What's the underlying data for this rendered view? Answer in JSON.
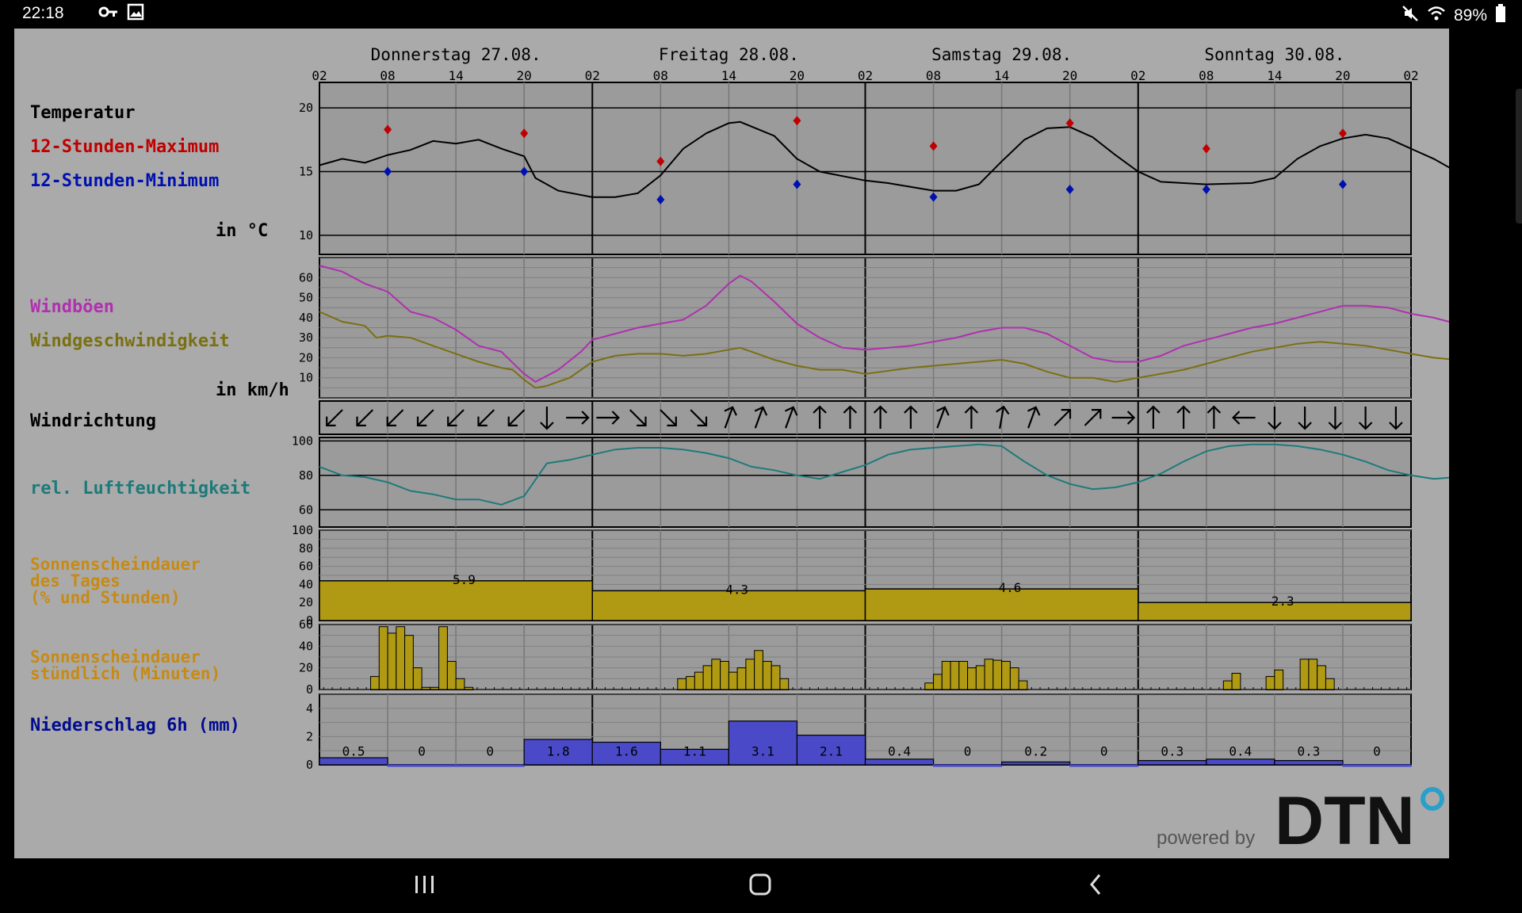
{
  "status_bar": {
    "time": "22:18",
    "battery": "89%"
  },
  "labels": {
    "temperatur": "Temperatur",
    "max": "12-Stunden-Maximum",
    "min": "12-Stunden-Minimum",
    "temp_unit": "in °C",
    "windboeen": "Windböen",
    "windgeschw": "Windgeschwindigkeit",
    "wind_unit": "in km/h",
    "windrichtung": "Windrichtung",
    "feuchte": "rel. Luftfeuchtigkeit",
    "sonne_tag_1": "Sonnenscheindauer",
    "sonne_tag_2": "des Tages",
    "sonne_tag_3": "(% und Stunden)",
    "sonne_std_1": "Sonnenscheindauer",
    "sonne_std_2": "stündlich (Minuten)",
    "niederschlag": "Niederschlag 6h (mm)"
  },
  "colors": {
    "max": "#c00000",
    "min": "#0010b0",
    "gusts": "#b030b0",
    "wind": "#7a7012",
    "humidity": "#1e7a7a",
    "sun_label": "#c88a14",
    "sun_fill": "#b09a14",
    "precip_label": "#000c90",
    "precip_fill": "#4a4ac8",
    "panel": "#9b9b9b",
    "grid": "#777777"
  },
  "branding": {
    "powered_by": "powered by",
    "logo": "DTN"
  },
  "chart_data": {
    "type": "multi-panel meteogram",
    "days": [
      "Donnerstag 27.08.",
      "Freitag 28.08.",
      "Samstag 29.08.",
      "Sonntag 30.08."
    ],
    "hour_ticks": [
      "02",
      "08",
      "14",
      "20",
      "02",
      "08",
      "14",
      "20",
      "02",
      "08",
      "14",
      "20",
      "02",
      "08",
      "14",
      "20",
      "02"
    ],
    "temperature": {
      "yticks": [
        10,
        15,
        20
      ],
      "ylim": [
        8.5,
        22
      ],
      "curve": [
        [
          2,
          15.5
        ],
        [
          4,
          16
        ],
        [
          6,
          15.7
        ],
        [
          8,
          16.3
        ],
        [
          10,
          16.7
        ],
        [
          12,
          17.4
        ],
        [
          14,
          17.2
        ],
        [
          16,
          17.5
        ],
        [
          18,
          16.8
        ],
        [
          20,
          16.2
        ],
        [
          21,
          14.5
        ],
        [
          23,
          13.5
        ],
        [
          26,
          13.0
        ],
        [
          28,
          13.0
        ],
        [
          30,
          13.3
        ],
        [
          32,
          14.7
        ],
        [
          34,
          16.8
        ],
        [
          36,
          18.0
        ],
        [
          38,
          18.8
        ],
        [
          39,
          18.9
        ],
        [
          42,
          17.8
        ],
        [
          44,
          16.0
        ],
        [
          46,
          15.0
        ],
        [
          50,
          14.3
        ],
        [
          52,
          14.1
        ],
        [
          56,
          13.5
        ],
        [
          58,
          13.5
        ],
        [
          60,
          14.0
        ],
        [
          62,
          15.8
        ],
        [
          64,
          17.5
        ],
        [
          66,
          18.4
        ],
        [
          68,
          18.5
        ],
        [
          70,
          17.7
        ],
        [
          72,
          16.3
        ],
        [
          74,
          15.0
        ],
        [
          76,
          14.2
        ],
        [
          80,
          14.0
        ],
        [
          84,
          14.1
        ],
        [
          86,
          14.5
        ],
        [
          88,
          16.0
        ],
        [
          90,
          17.0
        ],
        [
          92,
          17.6
        ],
        [
          94,
          17.9
        ],
        [
          96,
          17.6
        ],
        [
          98,
          16.8
        ],
        [
          100,
          16.0
        ],
        [
          102,
          15.0
        ],
        [
          104,
          14.6
        ],
        [
          106,
          14.1
        ],
        [
          108,
          13.7
        ]
      ],
      "max_points": [
        [
          8,
          18.3
        ],
        [
          20,
          18.0
        ],
        [
          32,
          15.8
        ],
        [
          44,
          19.0
        ],
        [
          56,
          17.0
        ],
        [
          68,
          18.8
        ],
        [
          80,
          16.8
        ],
        [
          92,
          18.0
        ]
      ],
      "min_points": [
        [
          8,
          15.0
        ],
        [
          20,
          15.0
        ],
        [
          32,
          12.8
        ],
        [
          44,
          14.0
        ],
        [
          56,
          13.0
        ],
        [
          68,
          13.6
        ],
        [
          80,
          13.6
        ],
        [
          92,
          14.0
        ]
      ]
    },
    "wind": {
      "yticks": [
        10,
        20,
        30,
        40,
        50,
        60
      ],
      "ylim": [
        0,
        70
      ],
      "gusts": [
        [
          2,
          66
        ],
        [
          4,
          63
        ],
        [
          6,
          57
        ],
        [
          8,
          53
        ],
        [
          10,
          43
        ],
        [
          12,
          40
        ],
        [
          14,
          34
        ],
        [
          16,
          26
        ],
        [
          18,
          23
        ],
        [
          20,
          12
        ],
        [
          21,
          8
        ],
        [
          23,
          14
        ],
        [
          25,
          23
        ],
        [
          26,
          29
        ],
        [
          28,
          32
        ],
        [
          30,
          35
        ],
        [
          32,
          37
        ],
        [
          34,
          39
        ],
        [
          36,
          46
        ],
        [
          38,
          57
        ],
        [
          39,
          61
        ],
        [
          40,
          58
        ],
        [
          42,
          48
        ],
        [
          44,
          37
        ],
        [
          46,
          30
        ],
        [
          48,
          25
        ],
        [
          50,
          24
        ],
        [
          54,
          26
        ],
        [
          56,
          28
        ],
        [
          58,
          30
        ],
        [
          60,
          33
        ],
        [
          62,
          35
        ],
        [
          64,
          35
        ],
        [
          66,
          32
        ],
        [
          68,
          26
        ],
        [
          70,
          20
        ],
        [
          72,
          18
        ],
        [
          74,
          18
        ],
        [
          76,
          21
        ],
        [
          78,
          26
        ],
        [
          80,
          29
        ],
        [
          82,
          32
        ],
        [
          84,
          35
        ],
        [
          86,
          37
        ],
        [
          88,
          40
        ],
        [
          90,
          43
        ],
        [
          92,
          46
        ],
        [
          94,
          46
        ],
        [
          96,
          45
        ],
        [
          98,
          42
        ],
        [
          100,
          40
        ],
        [
          102,
          37
        ],
        [
          104,
          35
        ],
        [
          106,
          33
        ]
      ],
      "speed": [
        [
          2,
          43
        ],
        [
          4,
          38
        ],
        [
          6,
          36
        ],
        [
          7,
          30
        ],
        [
          8,
          31
        ],
        [
          10,
          30
        ],
        [
          12,
          26
        ],
        [
          14,
          22
        ],
        [
          16,
          18
        ],
        [
          18,
          15
        ],
        [
          19,
          14
        ],
        [
          20,
          9
        ],
        [
          21,
          5
        ],
        [
          22,
          6
        ],
        [
          24,
          10
        ],
        [
          26,
          18
        ],
        [
          28,
          21
        ],
        [
          30,
          22
        ],
        [
          32,
          22
        ],
        [
          34,
          21
        ],
        [
          36,
          22
        ],
        [
          38,
          24
        ],
        [
          39,
          25
        ],
        [
          40,
          23
        ],
        [
          42,
          19
        ],
        [
          44,
          16
        ],
        [
          46,
          14
        ],
        [
          48,
          14
        ],
        [
          50,
          12
        ],
        [
          54,
          15
        ],
        [
          56,
          16
        ],
        [
          58,
          17
        ],
        [
          60,
          18
        ],
        [
          62,
          19
        ],
        [
          64,
          17
        ],
        [
          66,
          13
        ],
        [
          68,
          10
        ],
        [
          70,
          10
        ],
        [
          72,
          8
        ],
        [
          74,
          10
        ],
        [
          76,
          12
        ],
        [
          78,
          14
        ],
        [
          80,
          17
        ],
        [
          82,
          20
        ],
        [
          84,
          23
        ],
        [
          86,
          25
        ],
        [
          88,
          27
        ],
        [
          90,
          28
        ],
        [
          92,
          27
        ],
        [
          94,
          26
        ],
        [
          96,
          24
        ],
        [
          98,
          22
        ],
        [
          100,
          20
        ],
        [
          102,
          19
        ],
        [
          104,
          17
        ]
      ]
    },
    "wind_direction_deg": [
      45,
      45,
      45,
      45,
      45,
      45,
      45,
      0,
      270,
      270,
      315,
      315,
      315,
      200,
      200,
      200,
      180,
      180,
      180,
      180,
      200,
      180,
      190,
      200,
      225,
      225,
      270,
      180,
      180,
      180,
      90,
      0,
      0,
      0,
      0,
      0
    ],
    "humidity": {
      "yticks": [
        60,
        80,
        100
      ],
      "ylim": [
        50,
        102
      ],
      "curve": [
        [
          2,
          85
        ],
        [
          4,
          80
        ],
        [
          6,
          79
        ],
        [
          8,
          76
        ],
        [
          10,
          71
        ],
        [
          12,
          69
        ],
        [
          14,
          66
        ],
        [
          16,
          66
        ],
        [
          18,
          63
        ],
        [
          20,
          68
        ],
        [
          22,
          87
        ],
        [
          24,
          89
        ],
        [
          26,
          92
        ],
        [
          28,
          95
        ],
        [
          30,
          96
        ],
        [
          32,
          96
        ],
        [
          34,
          95
        ],
        [
          36,
          93
        ],
        [
          38,
          90
        ],
        [
          40,
          85
        ],
        [
          42,
          83
        ],
        [
          44,
          80
        ],
        [
          46,
          78
        ],
        [
          48,
          82
        ],
        [
          50,
          86
        ],
        [
          52,
          92
        ],
        [
          54,
          95
        ],
        [
          56,
          96
        ],
        [
          58,
          97
        ],
        [
          60,
          98
        ],
        [
          62,
          97
        ],
        [
          64,
          88
        ],
        [
          66,
          80
        ],
        [
          68,
          75
        ],
        [
          70,
          72
        ],
        [
          72,
          73
        ],
        [
          74,
          76
        ],
        [
          76,
          81
        ],
        [
          78,
          88
        ],
        [
          80,
          94
        ],
        [
          82,
          97
        ],
        [
          84,
          98
        ],
        [
          86,
          98
        ],
        [
          88,
          97
        ],
        [
          90,
          95
        ],
        [
          92,
          92
        ],
        [
          94,
          88
        ],
        [
          96,
          83
        ],
        [
          98,
          80
        ],
        [
          100,
          78
        ],
        [
          102,
          79
        ],
        [
          104,
          80
        ],
        [
          106,
          81
        ]
      ]
    },
    "sunshine_daily": {
      "yticks": [
        0,
        20,
        40,
        60,
        80,
        100
      ],
      "ylim": [
        0,
        100
      ],
      "percent": [
        44,
        33,
        35,
        20
      ],
      "hours": [
        "5.9",
        "4.3",
        "4.6",
        "2.3"
      ]
    },
    "sunshine_hourly": {
      "yticks": [
        0,
        20,
        40,
        60
      ],
      "ylim": [
        0,
        60
      ],
      "minutes": [
        0,
        0,
        0,
        0,
        0,
        0,
        12,
        58,
        52,
        58,
        50,
        20,
        2,
        2,
        58,
        26,
        10,
        2,
        0,
        0,
        0,
        0,
        0,
        0,
        0,
        0,
        0,
        0,
        0,
        0,
        0,
        0,
        0,
        0,
        0,
        0,
        0,
        0,
        0,
        0,
        0,
        0,
        10,
        12,
        16,
        22,
        28,
        26,
        16,
        20,
        28,
        36,
        26,
        22,
        10,
        0,
        0,
        0,
        0,
        0,
        0,
        0,
        0,
        0,
        0,
        0,
        0,
        0,
        0,
        0,
        0,
        6,
        14,
        26,
        26,
        26,
        20,
        22,
        28,
        27,
        26,
        20,
        8,
        0,
        0,
        0,
        0,
        0,
        0,
        0,
        0,
        0,
        0,
        0,
        0,
        0,
        0,
        0,
        0,
        0,
        0,
        0,
        0,
        0,
        0,
        0,
        8,
        15,
        0,
        0,
        0,
        12,
        18,
        0,
        0,
        28,
        28,
        22,
        10,
        0,
        0,
        0,
        0,
        0,
        0,
        0,
        0,
        0
      ]
    },
    "precipitation_6h": {
      "yticks": [
        0,
        2,
        4
      ],
      "ylim": [
        0,
        5
      ],
      "values": [
        0.5,
        0,
        0,
        1.8,
        1.6,
        1.1,
        3.1,
        2.1,
        0.4,
        0,
        0.2,
        0,
        0.3,
        0.4,
        0.3,
        0
      ],
      "labels": [
        "0.5",
        "0",
        "0",
        "1.8",
        "1.6",
        "1.1",
        "3.1",
        "2.1",
        "0.4",
        "0",
        "0.2",
        "0",
        "0.3",
        "0.4",
        "0.3",
        "0"
      ]
    }
  }
}
